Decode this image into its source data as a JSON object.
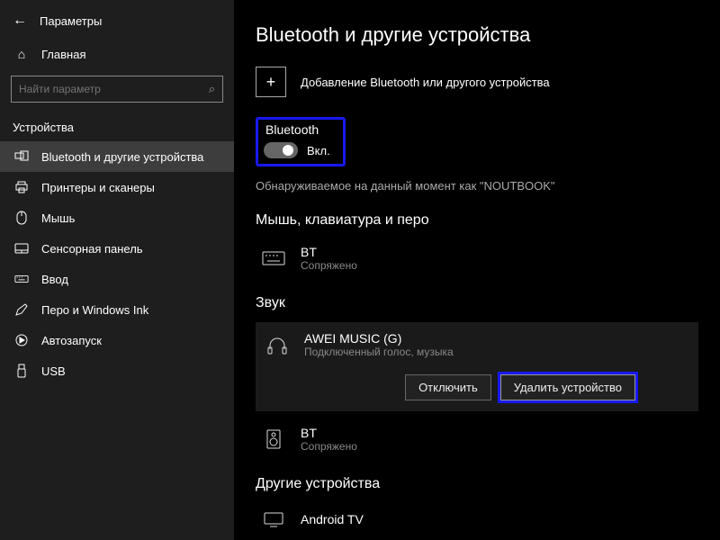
{
  "app": {
    "title": "Параметры"
  },
  "sidebar": {
    "home": "Главная",
    "search_placeholder": "Найти параметр",
    "category": "Устройства",
    "items": [
      {
        "label": "Bluetooth и другие устройства"
      },
      {
        "label": "Принтеры и сканеры"
      },
      {
        "label": "Мышь"
      },
      {
        "label": "Сенсорная панель"
      },
      {
        "label": "Ввод"
      },
      {
        "label": "Перо и Windows Ink"
      },
      {
        "label": "Автозапуск"
      },
      {
        "label": "USB"
      }
    ]
  },
  "main": {
    "title": "Bluetooth и другие устройства",
    "add_device": "Добавление Bluetooth или другого устройства",
    "bluetooth": {
      "label": "Bluetooth",
      "state": "Вкл."
    },
    "discoverable": "Обнаруживаемое на данный момент как \"NOUTBOOK\"",
    "section_mouse": "Мышь, клавиатура и перо",
    "dev_bt1": {
      "name": "BT",
      "status": "Сопряжено"
    },
    "section_sound": "Звук",
    "dev_awei": {
      "name": "AWEI MUSIC (G)",
      "status": "Подключенный голос, музыка"
    },
    "btn_disconnect": "Отключить",
    "btn_remove": "Удалить устройство",
    "dev_bt2": {
      "name": "BT",
      "status": "Сопряжено"
    },
    "section_other": "Другие устройства",
    "dev_tv": {
      "name": "Android TV"
    }
  }
}
